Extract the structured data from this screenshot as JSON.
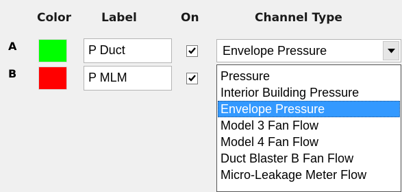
{
  "headers": {
    "color": "Color",
    "label": "Label",
    "on": "On",
    "channel_type": "Channel Type"
  },
  "rows": [
    {
      "letter": "A",
      "color": "#00ff00",
      "label_value": "P Duct",
      "on_checked": true
    },
    {
      "letter": "B",
      "color": "#ff0000",
      "label_value": "P MLM",
      "on_checked": true
    }
  ],
  "channel_combo": {
    "selected": "Envelope Pressure",
    "options": [
      "Pressure",
      "Interior Building Pressure",
      "Envelope Pressure",
      "Model 3 Fan Flow",
      "Model 4 Fan Flow",
      "Duct Blaster B Fan Flow",
      "Micro-Leakage Meter Flow"
    ],
    "highlighted_index": 2,
    "highlight_color": "#3399ff"
  }
}
